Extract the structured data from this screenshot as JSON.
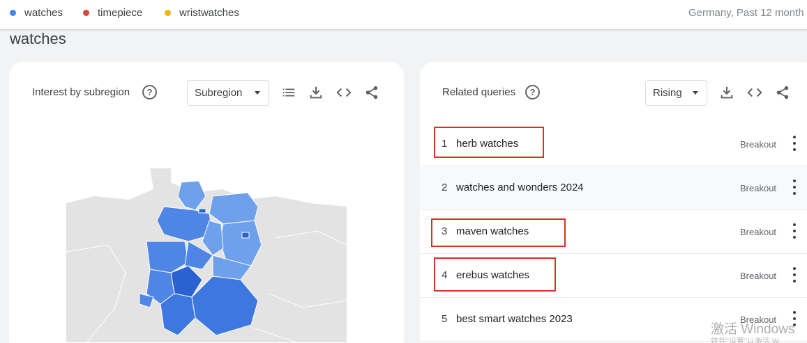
{
  "header": {
    "terms": [
      {
        "label": "watches",
        "color": "#4285f4"
      },
      {
        "label": "timepiece",
        "color": "#db4437"
      },
      {
        "label": "wristwatches",
        "color": "#f4b400"
      }
    ],
    "region_period": "Germany, Past 12 month"
  },
  "page_title": "watches",
  "left_card": {
    "title": "Interest by subregion",
    "help": "?",
    "dropdown_value": "Subregion",
    "tools": [
      "list-icon",
      "download-icon",
      "embed-icon",
      "share-icon"
    ]
  },
  "right_card": {
    "title": "Related queries",
    "help": "?",
    "dropdown_value": "Rising",
    "tools": [
      "download-icon",
      "embed-icon",
      "share-icon"
    ],
    "rows": [
      {
        "rank": "1",
        "query": "herb watches",
        "value": "Breakout"
      },
      {
        "rank": "2",
        "query": "watches and wonders 2024",
        "value": "Breakout"
      },
      {
        "rank": "3",
        "query": "maven watches",
        "value": "Breakout"
      },
      {
        "rank": "4",
        "query": "erebus watches",
        "value": "Breakout"
      },
      {
        "rank": "5",
        "query": "best smart watches 2023",
        "value": "Breakout"
      }
    ]
  },
  "watermark": {
    "line1": "激活 Windows",
    "line2": "转到\"设置\"以激活 W"
  },
  "colors": {
    "highlight": "#d93025",
    "map_light": "#6ea0ec",
    "map_mid": "#4f86e6",
    "map_dark": "#2a62d2"
  }
}
